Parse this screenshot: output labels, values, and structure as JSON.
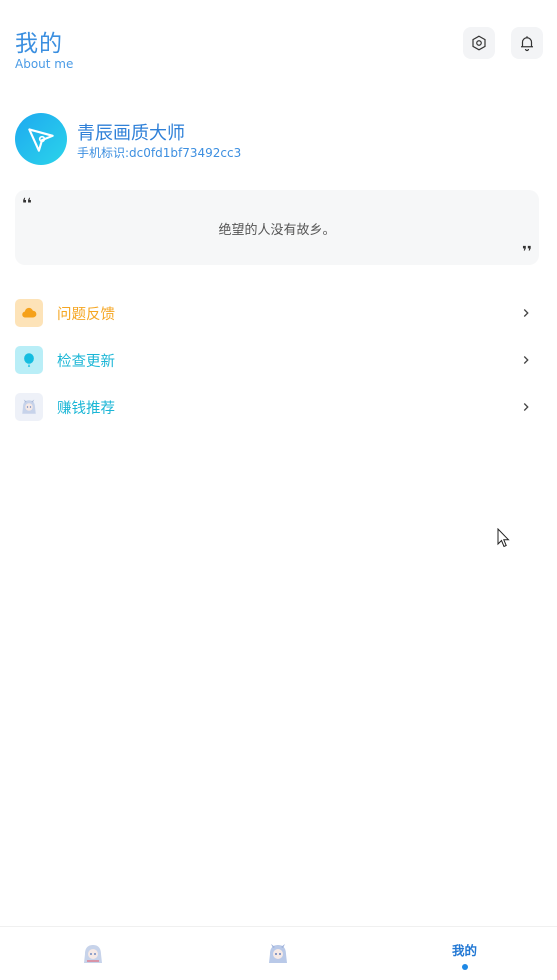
{
  "header": {
    "title": "我的",
    "subtitle": "About me",
    "settings_icon": "hexagon-settings-icon",
    "bell_icon": "bell-icon"
  },
  "profile": {
    "name": "青辰画质大师",
    "device_id": "手机标识:dc0fd1bf73492cc3",
    "avatar_icon": "paper-plane-icon",
    "avatar_colors": [
      "#1ea9f0",
      "#2bd4ea"
    ]
  },
  "quote": {
    "open_mark": "❛❛",
    "text": "绝望的人没有故乡。",
    "close_mark": "❜❜"
  },
  "menu": [
    {
      "label": "问题反馈",
      "icon": "cloud-icon",
      "color": "#f5a623"
    },
    {
      "label": "检查更新",
      "icon": "balloon-icon",
      "color": "#1bb6d6"
    },
    {
      "label": "赚钱推荐",
      "icon": "anime-avatar-icon",
      "color": "#1bb6d6"
    }
  ],
  "bottom_nav": {
    "items": [
      {
        "label": "",
        "icon": "anime-avatar-icon"
      },
      {
        "label": "",
        "icon": "anime-avatar-icon"
      },
      {
        "label": "我的",
        "active": true
      }
    ],
    "active_color": "#2278d4"
  }
}
